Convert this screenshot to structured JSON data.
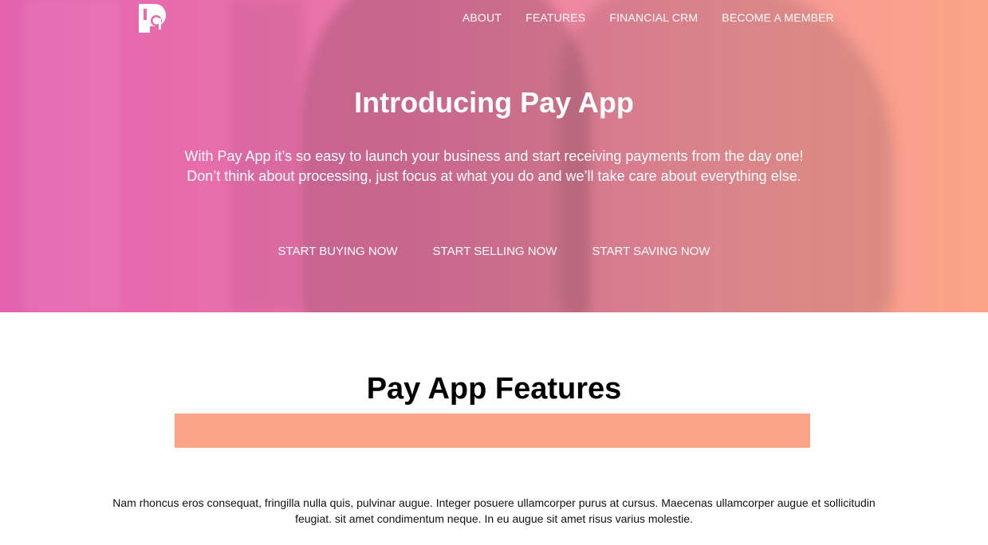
{
  "brand": {
    "logo_icon": "pay-app-logo-icon"
  },
  "nav": {
    "items": [
      {
        "label": "ABOUT"
      },
      {
        "label": "FEATURES"
      },
      {
        "label": "FINANCIAL CRM"
      },
      {
        "label": "BECOME A MEMBER"
      }
    ]
  },
  "hero": {
    "title": "Introducing Pay App",
    "text_line1": "With Pay App it’s so easy to launch your business and start receiving payments from the day one!",
    "text_line2": "Don’t think about processing, just focus at what you do and we’ll take care about everything else.",
    "cta": [
      {
        "label": "START BUYING NOW"
      },
      {
        "label": "START SELLING NOW"
      },
      {
        "label": "START SAVING NOW"
      }
    ],
    "gradient_start": "#e462b0",
    "gradient_end": "#fba486"
  },
  "features": {
    "title": "Pay App Features",
    "bar_color": "#fba486",
    "text": "Nam rhoncus eros consequat, fringilla nulla quis, pulvinar augue. Integer posuere ullamcorper purus at cursus. Maecenas ullamcorper augue et sollicitudin feugiat. sit amet condimentum neque. In eu augue sit amet risus varius molestie."
  }
}
